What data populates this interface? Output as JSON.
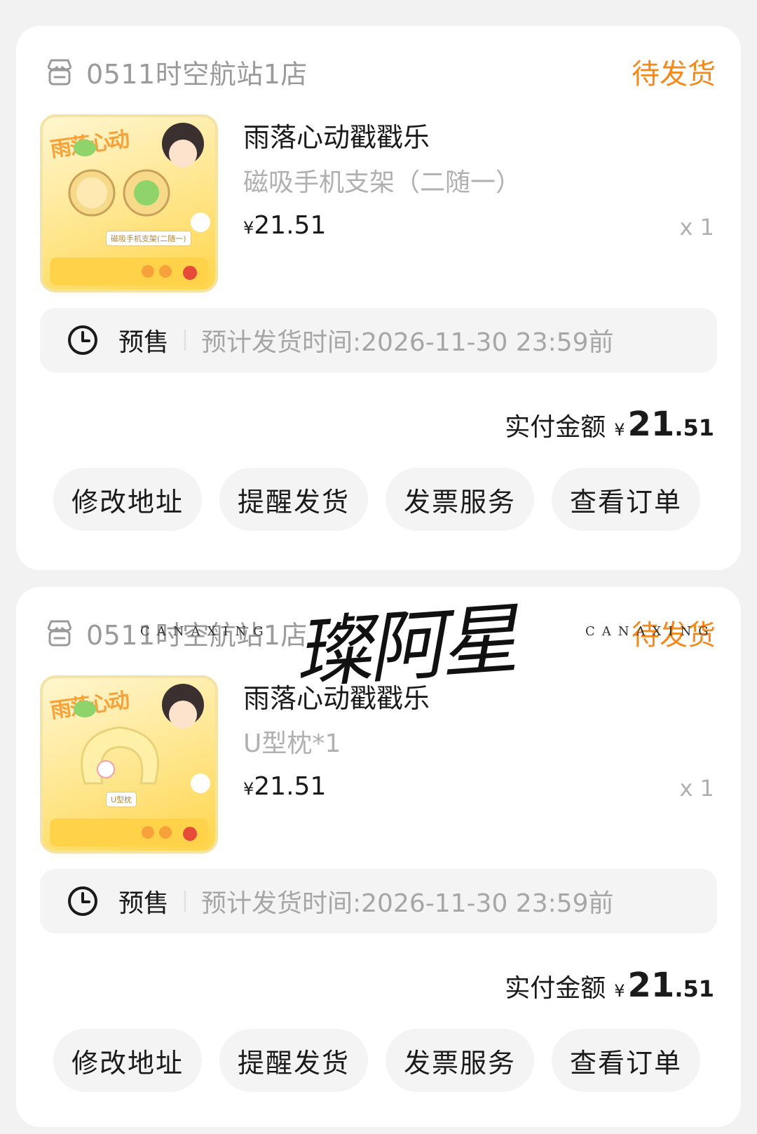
{
  "orders": [
    {
      "store_name": "0511时空航站1店",
      "status": "待发货",
      "product_name": "雨落心动戳戳乐",
      "product_spec": "磁吸手机支架（二随一）",
      "price": "21.51",
      "quantity": "x 1",
      "thumb_title": "雨落心动",
      "thumb_tag": "磁吸手机支架(二随一)",
      "presale_label": "预售",
      "presale_time": "预计发货时间:2026-11-30 23:59前",
      "paid_label": "实付金额",
      "paid_int": "21",
      "paid_dec": ".51",
      "actions": [
        "修改地址",
        "提醒发货",
        "发票服务",
        "查看订单"
      ]
    },
    {
      "store_name": "0511时空航站1店",
      "status": "待发货",
      "product_name": "雨落心动戳戳乐",
      "product_spec": "U型枕*1",
      "price": "21.51",
      "quantity": "x 1",
      "thumb_title": "雨落心动",
      "thumb_tag": "U型枕",
      "presale_label": "预售",
      "presale_time": "预计发货时间:2026-11-30 23:59前",
      "paid_label": "实付金额",
      "paid_int": "21",
      "paid_dec": ".51",
      "actions": [
        "修改地址",
        "提醒发货",
        "发票服务",
        "查看订单"
      ]
    }
  ],
  "currency": "¥",
  "watermark": {
    "main": "璨阿星",
    "sub": "CANAXING"
  },
  "colors": {
    "status": "#f28a1e",
    "background": "#f2f2f2",
    "card": "#ffffff"
  },
  "icons": {
    "store": "store-icon",
    "clock": "clock-icon"
  }
}
